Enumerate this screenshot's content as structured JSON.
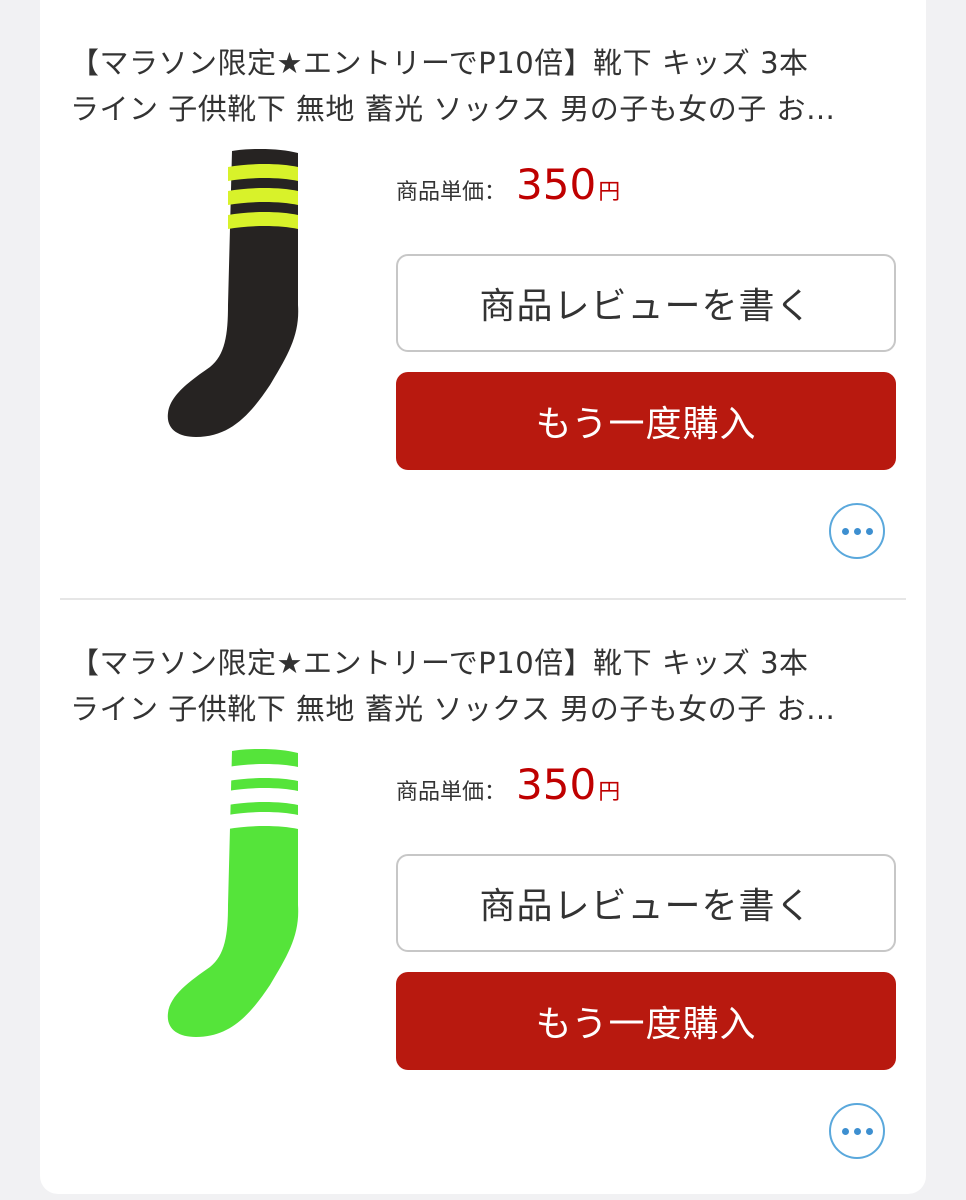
{
  "items": [
    {
      "title_line1": "【マラソン限定★エントリーでP10倍】靴下 キッズ 3本",
      "title_line2": "ライン 子供靴下 無地 蓄光 ソックス 男の子も女の子 お…",
      "price_label": "商品単価：",
      "price_value": "350",
      "price_unit": "円",
      "review_button": "商品レビューを書く",
      "rebuy_button": "もう一度購入",
      "more_icon": "ellipsis-icon",
      "sock_color": "#262322",
      "stripe_color": "#d8f22a"
    },
    {
      "title_line1": "【マラソン限定★エントリーでP10倍】靴下 キッズ 3本",
      "title_line2": "ライン 子供靴下 無地 蓄光 ソックス 男の子も女の子 お…",
      "price_label": "商品単価：",
      "price_value": "350",
      "price_unit": "円",
      "review_button": "商品レビューを書く",
      "rebuy_button": "もう一度購入",
      "more_icon": "ellipsis-icon",
      "sock_color": "#55e43a",
      "stripe_color": "#ffffff"
    }
  ],
  "colors": {
    "accent_red": "#bf0000",
    "button_red": "#b8190f",
    "link_blue": "#3d8fd0"
  }
}
